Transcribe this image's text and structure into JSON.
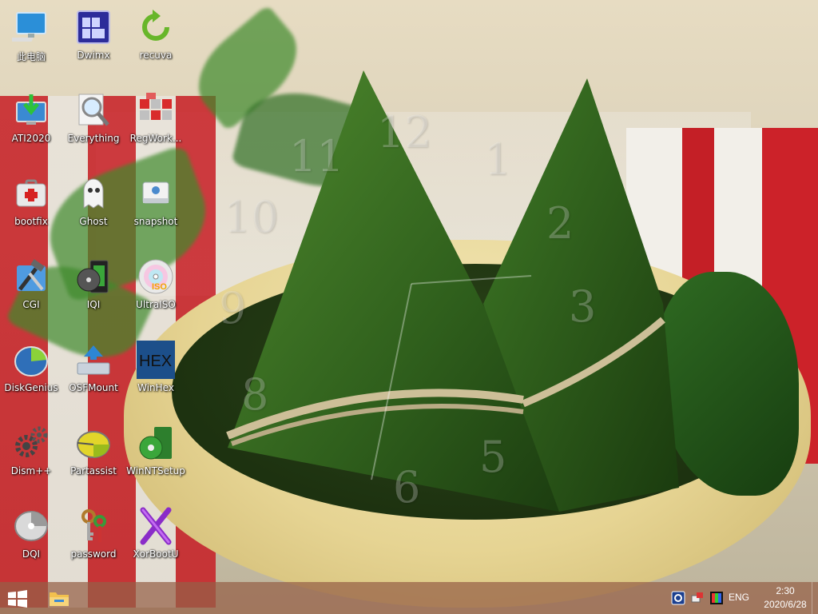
{
  "desktop_icons": [
    {
      "label": "此电脑",
      "icon": "computer-icon"
    },
    {
      "label": "Dwimx",
      "icon": "dwimx-icon"
    },
    {
      "label": "recuva",
      "icon": "recuva-icon"
    },
    {
      "label": "ATI2020",
      "icon": "ati-icon"
    },
    {
      "label": "Everything",
      "icon": "magnifier-icon"
    },
    {
      "label": "RegWork...",
      "icon": "registry-cubes-icon"
    },
    {
      "label": "bootfix",
      "icon": "first-aid-kit-icon"
    },
    {
      "label": "Ghost",
      "icon": "ghost-icon"
    },
    {
      "label": "snapshot",
      "icon": "drive-icon"
    },
    {
      "label": "CGI",
      "icon": "hammer-wrench-icon"
    },
    {
      "label": "IQI",
      "icon": "disc-media-icon"
    },
    {
      "label": "UltraISO",
      "icon": "iso-disc-icon"
    },
    {
      "label": "DiskGenius",
      "icon": "disk-pie-icon"
    },
    {
      "label": "OSFMount",
      "icon": "mount-drive-icon"
    },
    {
      "label": "WinHex",
      "icon": "hex-icon"
    },
    {
      "label": "Dism++",
      "icon": "gears-icon"
    },
    {
      "label": "Partassist",
      "icon": "partition-disc-icon"
    },
    {
      "label": "WinNTSetup",
      "icon": "windows-setup-icon"
    },
    {
      "label": "DQI",
      "icon": "disk-quick-icon"
    },
    {
      "label": "password",
      "icon": "keys-icon"
    },
    {
      "label": "XorBootU",
      "icon": "x-logo-icon"
    }
  ],
  "hex_text": "HEX",
  "iso_text": "ISO",
  "clock_face_numbers": [
    "12",
    "1",
    "2",
    "3",
    "5",
    "6",
    "8",
    "9",
    "10",
    "11"
  ],
  "taskbar": {
    "start_icon": "windows-logo-icon",
    "pinned": [
      {
        "icon": "folder-icon"
      }
    ],
    "tray": {
      "icons": [
        "screen-icon",
        "network-icon",
        "color-display-icon"
      ],
      "language": "ENG",
      "time": "2:30",
      "date": "2020/6/28"
    }
  },
  "colors": {
    "taskbar": "#96604a",
    "accent_red": "#c71d24",
    "leaf_green": "#2f6b22",
    "bamboo": "#e6d493"
  }
}
